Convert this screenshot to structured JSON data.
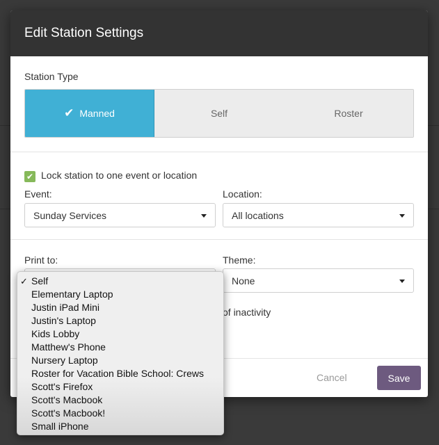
{
  "modal": {
    "title": "Edit Station Settings"
  },
  "station_type": {
    "label": "Station Type",
    "options": [
      "Manned",
      "Self",
      "Roster"
    ],
    "selected": "Manned"
  },
  "lock": {
    "label": "Lock station to one event or location",
    "checked": true,
    "event_label": "Event:",
    "event_value": "Sunday Services",
    "location_label": "Location:",
    "location_value": "All locations"
  },
  "print": {
    "print_label": "Print to:",
    "theme_label": "Theme:",
    "theme_value": "None",
    "inactivity_text_fragment": "of inactivity"
  },
  "print_dropdown": {
    "selected": "Self",
    "options": [
      "Self",
      "Elementary Laptop",
      "Justin iPad Mini",
      "Justin's Laptop",
      "Kids Lobby",
      "Matthew's Phone",
      "Nursery Laptop",
      "Roster for Vacation Bible School: Crews",
      "Scott's Firefox",
      "Scott's Macbook",
      "Scott's Macbook!",
      "Small iPhone"
    ]
  },
  "footer": {
    "cancel_label": "Cancel",
    "save_label": "Save"
  },
  "colors": {
    "header_bg": "#333333",
    "active_segment": "#40b0d5",
    "checkbox": "#86b95a",
    "save_button": "#6d5a7f"
  },
  "icons": {
    "segment_check": "check-icon",
    "checkbox_check": "checkmark-icon",
    "select_caret": "caret-down-icon",
    "menu_selected": "tick-icon"
  }
}
